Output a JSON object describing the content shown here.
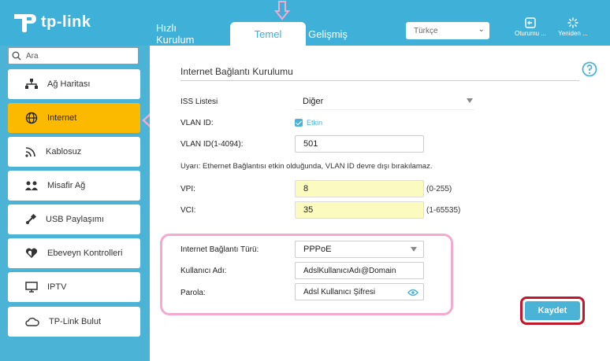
{
  "brand": {
    "name": "tp-link"
  },
  "tabs": [
    {
      "label": "Hızlı Kurulum"
    },
    {
      "label": "Temel"
    },
    {
      "label": "Gelişmiş"
    }
  ],
  "header": {
    "language": "Türkçe",
    "logout_label": "Oturumu ...",
    "reboot_label": "Yeniden ..."
  },
  "sidebar": {
    "search_placeholder": "Ara",
    "items": [
      {
        "label": "Ağ Haritası",
        "icon": "network-map-icon"
      },
      {
        "label": "Internet",
        "icon": "globe-icon",
        "active": true
      },
      {
        "label": "Kablosuz",
        "icon": "wifi-icon"
      },
      {
        "label": "Misafir Ağ",
        "icon": "guest-network-icon"
      },
      {
        "label": "USB Paylaşımı",
        "icon": "usb-icon"
      },
      {
        "label": "Ebeveyn Kontrolleri",
        "icon": "parental-controls-icon"
      },
      {
        "label": "IPTV",
        "icon": "monitor-icon"
      },
      {
        "label": "TP-Link Bulut",
        "icon": "cloud-icon"
      }
    ]
  },
  "form": {
    "title": "Internet Bağlantı Kurulumu",
    "isp_label": "ISS Listesi",
    "isp_value": "Diğer",
    "vlan_id_label": "VLAN ID:",
    "vlan_enable_label": "Etkin",
    "vlan_id_range_label": "VLAN ID(1-4094):",
    "vlan_id_value": "501",
    "warning": "Uyarı: Ethernet Bağlantısı etkin olduğunda, VLAN ID devre dışı bırakılamaz.",
    "vpi_label": "VPI:",
    "vpi_value": "8",
    "vpi_range": "(0-255)",
    "vci_label": "VCI:",
    "vci_value": "35",
    "vci_range": "(1-65535)",
    "conn_type_label": "Internet Bağlantı Türü:",
    "conn_type_value": "PPPoE",
    "username_label": "Kullanıcı Adı:",
    "username_value": "AdslKullanıcıAdı@Domain",
    "password_label": "Parola:",
    "password_value": "Adsl Kullanıcı Şifresi",
    "save_label": "Kaydet"
  },
  "colors": {
    "brand_blue": "#3fb0d8",
    "active_yellow": "#fbb900",
    "annotation_pink": "#f4a9cf",
    "annotation_red": "#c0182a",
    "input_yellow": "#fbfbc0"
  }
}
